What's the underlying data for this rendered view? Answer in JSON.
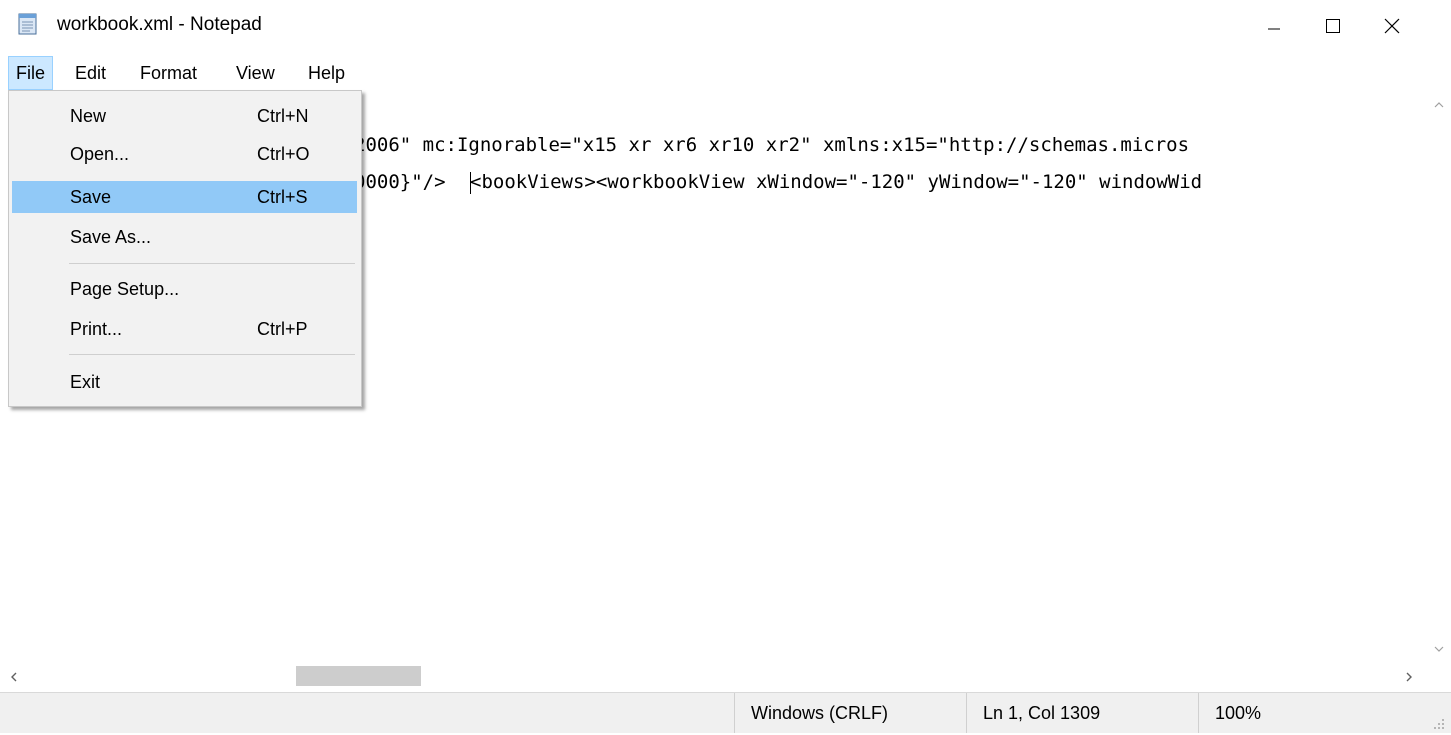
{
  "window": {
    "title": "workbook.xml - Notepad"
  },
  "menubar": {
    "items": [
      "File",
      "Edit",
      "Format",
      "View",
      "Help"
    ],
    "active": "File"
  },
  "file_menu": {
    "items": [
      {
        "label": "New",
        "shortcut": "Ctrl+N"
      },
      {
        "label": "Open...",
        "shortcut": "Ctrl+O"
      },
      {
        "label": "Save",
        "shortcut": "Ctrl+S",
        "highlighted": true
      },
      {
        "label": "Save As...",
        "shortcut": ""
      },
      {
        "label": "Page Setup...",
        "shortcut": ""
      },
      {
        "label": "Print...",
        "shortcut": "Ctrl+P"
      },
      {
        "label": "Exit",
        "shortcut": ""
      }
    ]
  },
  "editor": {
    "line1_visible": "2006\" mc:Ignorable=\"x15 xr xr6 xr10 xr2\" xmlns:x15=\"http://schemas.micros",
    "line2_before_caret": "0000}\"/>",
    "line2_after_caret": "<bookViews><workbookView xWindow=\"-120\" yWindow=\"-120\" windowWid"
  },
  "statusbar": {
    "line_endings": "Windows (CRLF)",
    "position": "Ln 1, Col 1309",
    "zoom": "100%"
  },
  "colors": {
    "menu_highlight": "#91c9f7",
    "active_menu": "#cce8ff",
    "menu_background": "#f2f2f2",
    "statusbar_background": "#f0f0f0"
  },
  "icons": {
    "app": "notepad-icon",
    "minimize": "minimize-icon",
    "maximize": "maximize-icon",
    "close": "close-icon"
  }
}
